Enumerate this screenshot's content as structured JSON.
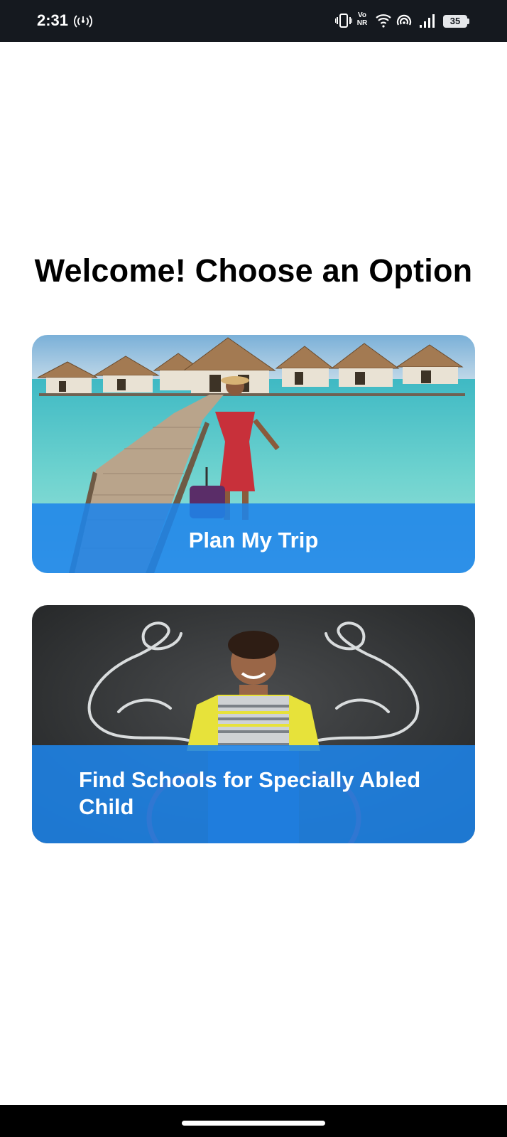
{
  "status_bar": {
    "time": "2:31",
    "network_label": "Vo\nNR",
    "battery_level": "35",
    "icons": [
      "hotspot-icon",
      "vibrate-icon",
      "volte-icon",
      "wifi-icon",
      "nfc-icon",
      "signal-icon",
      "battery-icon"
    ]
  },
  "page": {
    "title": "Welcome! Choose an Option"
  },
  "options": [
    {
      "label": "Plan My Trip",
      "image": "beach-resort-photo"
    },
    {
      "label": "Find Schools for Specially Abled Child",
      "image": "child-wheelchair-photo"
    }
  ],
  "colors": {
    "accent": "#1e84e9",
    "status_bar": "#15191f",
    "background": "#ffffff",
    "title_text": "#000000",
    "card_text": "#ffffff"
  }
}
